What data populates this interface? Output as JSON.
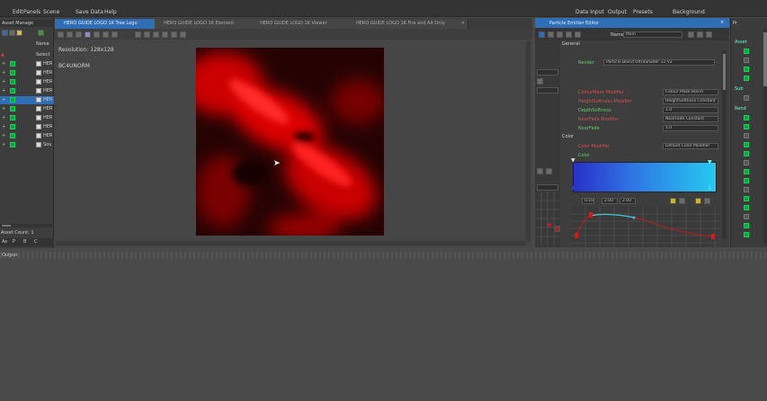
{
  "menu": {
    "items": [
      "Edit",
      "Panels",
      "Scene",
      "Save Data",
      "Help"
    ],
    "right": [
      "Data Input",
      "Output",
      "Presets",
      "Background"
    ]
  },
  "tabs": [
    {
      "label": "HERO GUIDE LOGO 1K Tree Logo",
      "active": true
    },
    {
      "label": "HERO GUIDE LOGO 1K Element"
    },
    {
      "label": "HERO GUIDE LOGO 1K Viewer"
    },
    {
      "label": "HERO GUIDE LOGO 1K Fire and Alt Only"
    }
  ],
  "left": {
    "title": "Asset Manage",
    "column": "Name",
    "sub": "Select",
    "items": [
      "HER",
      "HER",
      "HER",
      "HER",
      "HER",
      "HER",
      "HER",
      "HER",
      "HER",
      "Sou"
    ],
    "count": "Asset Count: 1"
  },
  "viewport": {
    "resolution": "Resolution: 128x128",
    "format": "BC4UNORM"
  },
  "props": {
    "title": "Particle Emitter Editor",
    "name_label": "Name",
    "name_value": "Main",
    "general_label": "General",
    "render_label": "Render",
    "render_value": "Particle Blend UltraShader 12 V2",
    "rows": [
      {
        "label": "ColourMask Modifier",
        "value": "Colour Mask Blend"
      },
      {
        "label": "HeightSoftness Modifier",
        "value": "HeightSoftness Constant"
      },
      {
        "label": "DepthSoftness",
        "value": "1.0"
      },
      {
        "label": "NearFade Modifier",
        "value": "NearFade Constant"
      },
      {
        "label": "NearFade",
        "value": "1.0"
      }
    ],
    "color_section": "Color",
    "color_mod_label": "Color Modifier",
    "color_mod_value": "Default Color Modifier",
    "color_label": "Color",
    "curve_values": [
      "0.10",
      "2.00",
      "2.00"
    ]
  },
  "right": {
    "header": "Pr",
    "items": [
      "Asset",
      "Sub",
      "Rend"
    ]
  },
  "colors": {
    "accent": "#2f6db5",
    "check": "#1f9a4a",
    "red": "#d11a1a"
  }
}
